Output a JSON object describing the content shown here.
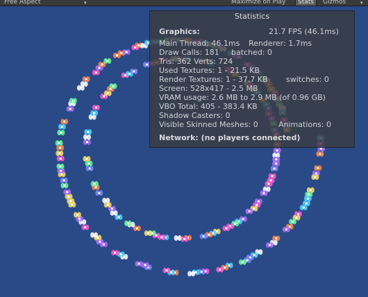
{
  "toolbar": {
    "aspect_label": "Free Aspect",
    "maximize_label": "Maximize on Play",
    "stats_label": "Stats",
    "gizmos_label": "Gizmos"
  },
  "stats": {
    "title": "Statistics",
    "graphics_label": "Graphics:",
    "fps": "21.7 FPS (46.1ms)",
    "main_thread": "Main Thread: 46.1ms",
    "renderer": "Renderer: 1.7ms",
    "draw_calls": "Draw Calls: 181",
    "batched": "batched: 0",
    "tris_verts": "Tris: 362  Verts: 724",
    "used_textures": "Used Textures: 1 - 21.5 KB",
    "render_textures": "Render Textures: 1 - 37.7 KB",
    "switches": "switches: 0",
    "screen": "Screen: 528x417 - 2.5 MB",
    "vram": "VRAM usage: 2.6 MB to 2.9 MB (of 0.96 GB)",
    "vbo": "VBO Total: 405 - 383.4 KB",
    "shadow_casters": "Shadow Casters: 0",
    "skinned_meshes": "Visible Skinned Meshes: 0",
    "animations": "Animations: 0",
    "network": "Network: (no players connected)"
  },
  "colors": {
    "background": "#2a4a87",
    "panel": "#3a3c42",
    "toolbar": "#3a3a3a"
  }
}
